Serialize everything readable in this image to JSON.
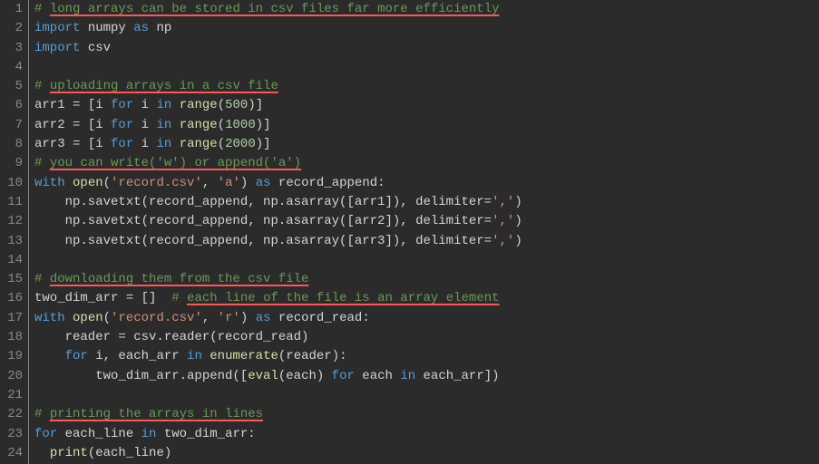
{
  "editor": {
    "lines": [
      [
        {
          "t": "# ",
          "c": "c"
        },
        {
          "t": "long arrays can be stored in csv files far more efficiently",
          "c": "cu"
        }
      ],
      [
        {
          "t": "import",
          "c": "kw"
        },
        {
          "t": " numpy ",
          "c": "id"
        },
        {
          "t": "as",
          "c": "kw"
        },
        {
          "t": " np",
          "c": "id"
        }
      ],
      [
        {
          "t": "import",
          "c": "kw"
        },
        {
          "t": " csv",
          "c": "id"
        }
      ],
      [],
      [
        {
          "t": "# ",
          "c": "c"
        },
        {
          "t": "uploading arrays in a csv file",
          "c": "cu"
        }
      ],
      [
        {
          "t": "arr1 ",
          "c": "id"
        },
        {
          "t": "=",
          "c": "op"
        },
        {
          "t": " [i ",
          "c": "id"
        },
        {
          "t": "for",
          "c": "kw"
        },
        {
          "t": " i ",
          "c": "id"
        },
        {
          "t": "in",
          "c": "kw"
        },
        {
          "t": " ",
          "c": "id"
        },
        {
          "t": "range",
          "c": "fn"
        },
        {
          "t": "(",
          "c": "op"
        },
        {
          "t": "500",
          "c": "num"
        },
        {
          "t": ")]",
          "c": "op"
        }
      ],
      [
        {
          "t": "arr2 ",
          "c": "id"
        },
        {
          "t": "=",
          "c": "op"
        },
        {
          "t": " [i ",
          "c": "id"
        },
        {
          "t": "for",
          "c": "kw"
        },
        {
          "t": " i ",
          "c": "id"
        },
        {
          "t": "in",
          "c": "kw"
        },
        {
          "t": " ",
          "c": "id"
        },
        {
          "t": "range",
          "c": "fn"
        },
        {
          "t": "(",
          "c": "op"
        },
        {
          "t": "1000",
          "c": "num"
        },
        {
          "t": ")]",
          "c": "op"
        }
      ],
      [
        {
          "t": "arr3 ",
          "c": "id"
        },
        {
          "t": "=",
          "c": "op"
        },
        {
          "t": " [i ",
          "c": "id"
        },
        {
          "t": "for",
          "c": "kw"
        },
        {
          "t": " i ",
          "c": "id"
        },
        {
          "t": "in",
          "c": "kw"
        },
        {
          "t": " ",
          "c": "id"
        },
        {
          "t": "range",
          "c": "fn"
        },
        {
          "t": "(",
          "c": "op"
        },
        {
          "t": "2000",
          "c": "num"
        },
        {
          "t": ")]",
          "c": "op"
        }
      ],
      [
        {
          "t": "# ",
          "c": "c"
        },
        {
          "t": "you can write('w') or append('a')",
          "c": "cu"
        }
      ],
      [
        {
          "t": "with",
          "c": "kw"
        },
        {
          "t": " ",
          "c": "id"
        },
        {
          "t": "open",
          "c": "fn"
        },
        {
          "t": "(",
          "c": "op"
        },
        {
          "t": "'record.csv'",
          "c": "str"
        },
        {
          "t": ", ",
          "c": "op"
        },
        {
          "t": "'a'",
          "c": "str"
        },
        {
          "t": ") ",
          "c": "op"
        },
        {
          "t": "as",
          "c": "kw"
        },
        {
          "t": " record_append:",
          "c": "id"
        }
      ],
      [
        {
          "t": "    np.savetxt(record_append, np.asarray([arr1]), delimiter=",
          "c": "id"
        },
        {
          "t": "','",
          "c": "str"
        },
        {
          "t": ")",
          "c": "op"
        }
      ],
      [
        {
          "t": "    np.savetxt(record_append, np.asarray([arr2]), delimiter=",
          "c": "id"
        },
        {
          "t": "','",
          "c": "str"
        },
        {
          "t": ")",
          "c": "op"
        }
      ],
      [
        {
          "t": "    np.savetxt(record_append, np.asarray([arr3]), delimiter=",
          "c": "id"
        },
        {
          "t": "','",
          "c": "str"
        },
        {
          "t": ")",
          "c": "op"
        }
      ],
      [],
      [
        {
          "t": "# ",
          "c": "c"
        },
        {
          "t": "downloading them from the csv file",
          "c": "cu"
        }
      ],
      [
        {
          "t": "two_dim_arr ",
          "c": "id"
        },
        {
          "t": "=",
          "c": "op"
        },
        {
          "t": " []  ",
          "c": "id"
        },
        {
          "t": "# ",
          "c": "c"
        },
        {
          "t": "each line of the file is an array element",
          "c": "cu"
        }
      ],
      [
        {
          "t": "with",
          "c": "kw"
        },
        {
          "t": " ",
          "c": "id"
        },
        {
          "t": "open",
          "c": "fn"
        },
        {
          "t": "(",
          "c": "op"
        },
        {
          "t": "'record.csv'",
          "c": "str"
        },
        {
          "t": ", ",
          "c": "op"
        },
        {
          "t": "'r'",
          "c": "str"
        },
        {
          "t": ") ",
          "c": "op"
        },
        {
          "t": "as",
          "c": "kw"
        },
        {
          "t": " record_read:",
          "c": "id"
        }
      ],
      [
        {
          "t": "    reader ",
          "c": "id"
        },
        {
          "t": "=",
          "c": "op"
        },
        {
          "t": " csv.reader(record_read)",
          "c": "id"
        }
      ],
      [
        {
          "t": "    ",
          "c": "id"
        },
        {
          "t": "for",
          "c": "kw"
        },
        {
          "t": " i, each_arr ",
          "c": "id"
        },
        {
          "t": "in",
          "c": "kw"
        },
        {
          "t": " ",
          "c": "id"
        },
        {
          "t": "enumerate",
          "c": "fn"
        },
        {
          "t": "(reader):",
          "c": "id"
        }
      ],
      [
        {
          "t": "        two_dim_arr.append([",
          "c": "id"
        },
        {
          "t": "eval",
          "c": "fn"
        },
        {
          "t": "(each) ",
          "c": "id"
        },
        {
          "t": "for",
          "c": "kw"
        },
        {
          "t": " each ",
          "c": "id"
        },
        {
          "t": "in",
          "c": "kw"
        },
        {
          "t": " each_arr])",
          "c": "id"
        }
      ],
      [],
      [
        {
          "t": "# ",
          "c": "c"
        },
        {
          "t": "printing the arrays in lines",
          "c": "cu"
        }
      ],
      [
        {
          "t": "for",
          "c": "kw"
        },
        {
          "t": " each_line ",
          "c": "id"
        },
        {
          "t": "in",
          "c": "kw"
        },
        {
          "t": " two_dim_arr:",
          "c": "id"
        }
      ],
      [
        {
          "t": "  ",
          "c": "id"
        },
        {
          "t": "print",
          "c": "fn"
        },
        {
          "t": "(each_line)",
          "c": "id"
        }
      ]
    ]
  }
}
